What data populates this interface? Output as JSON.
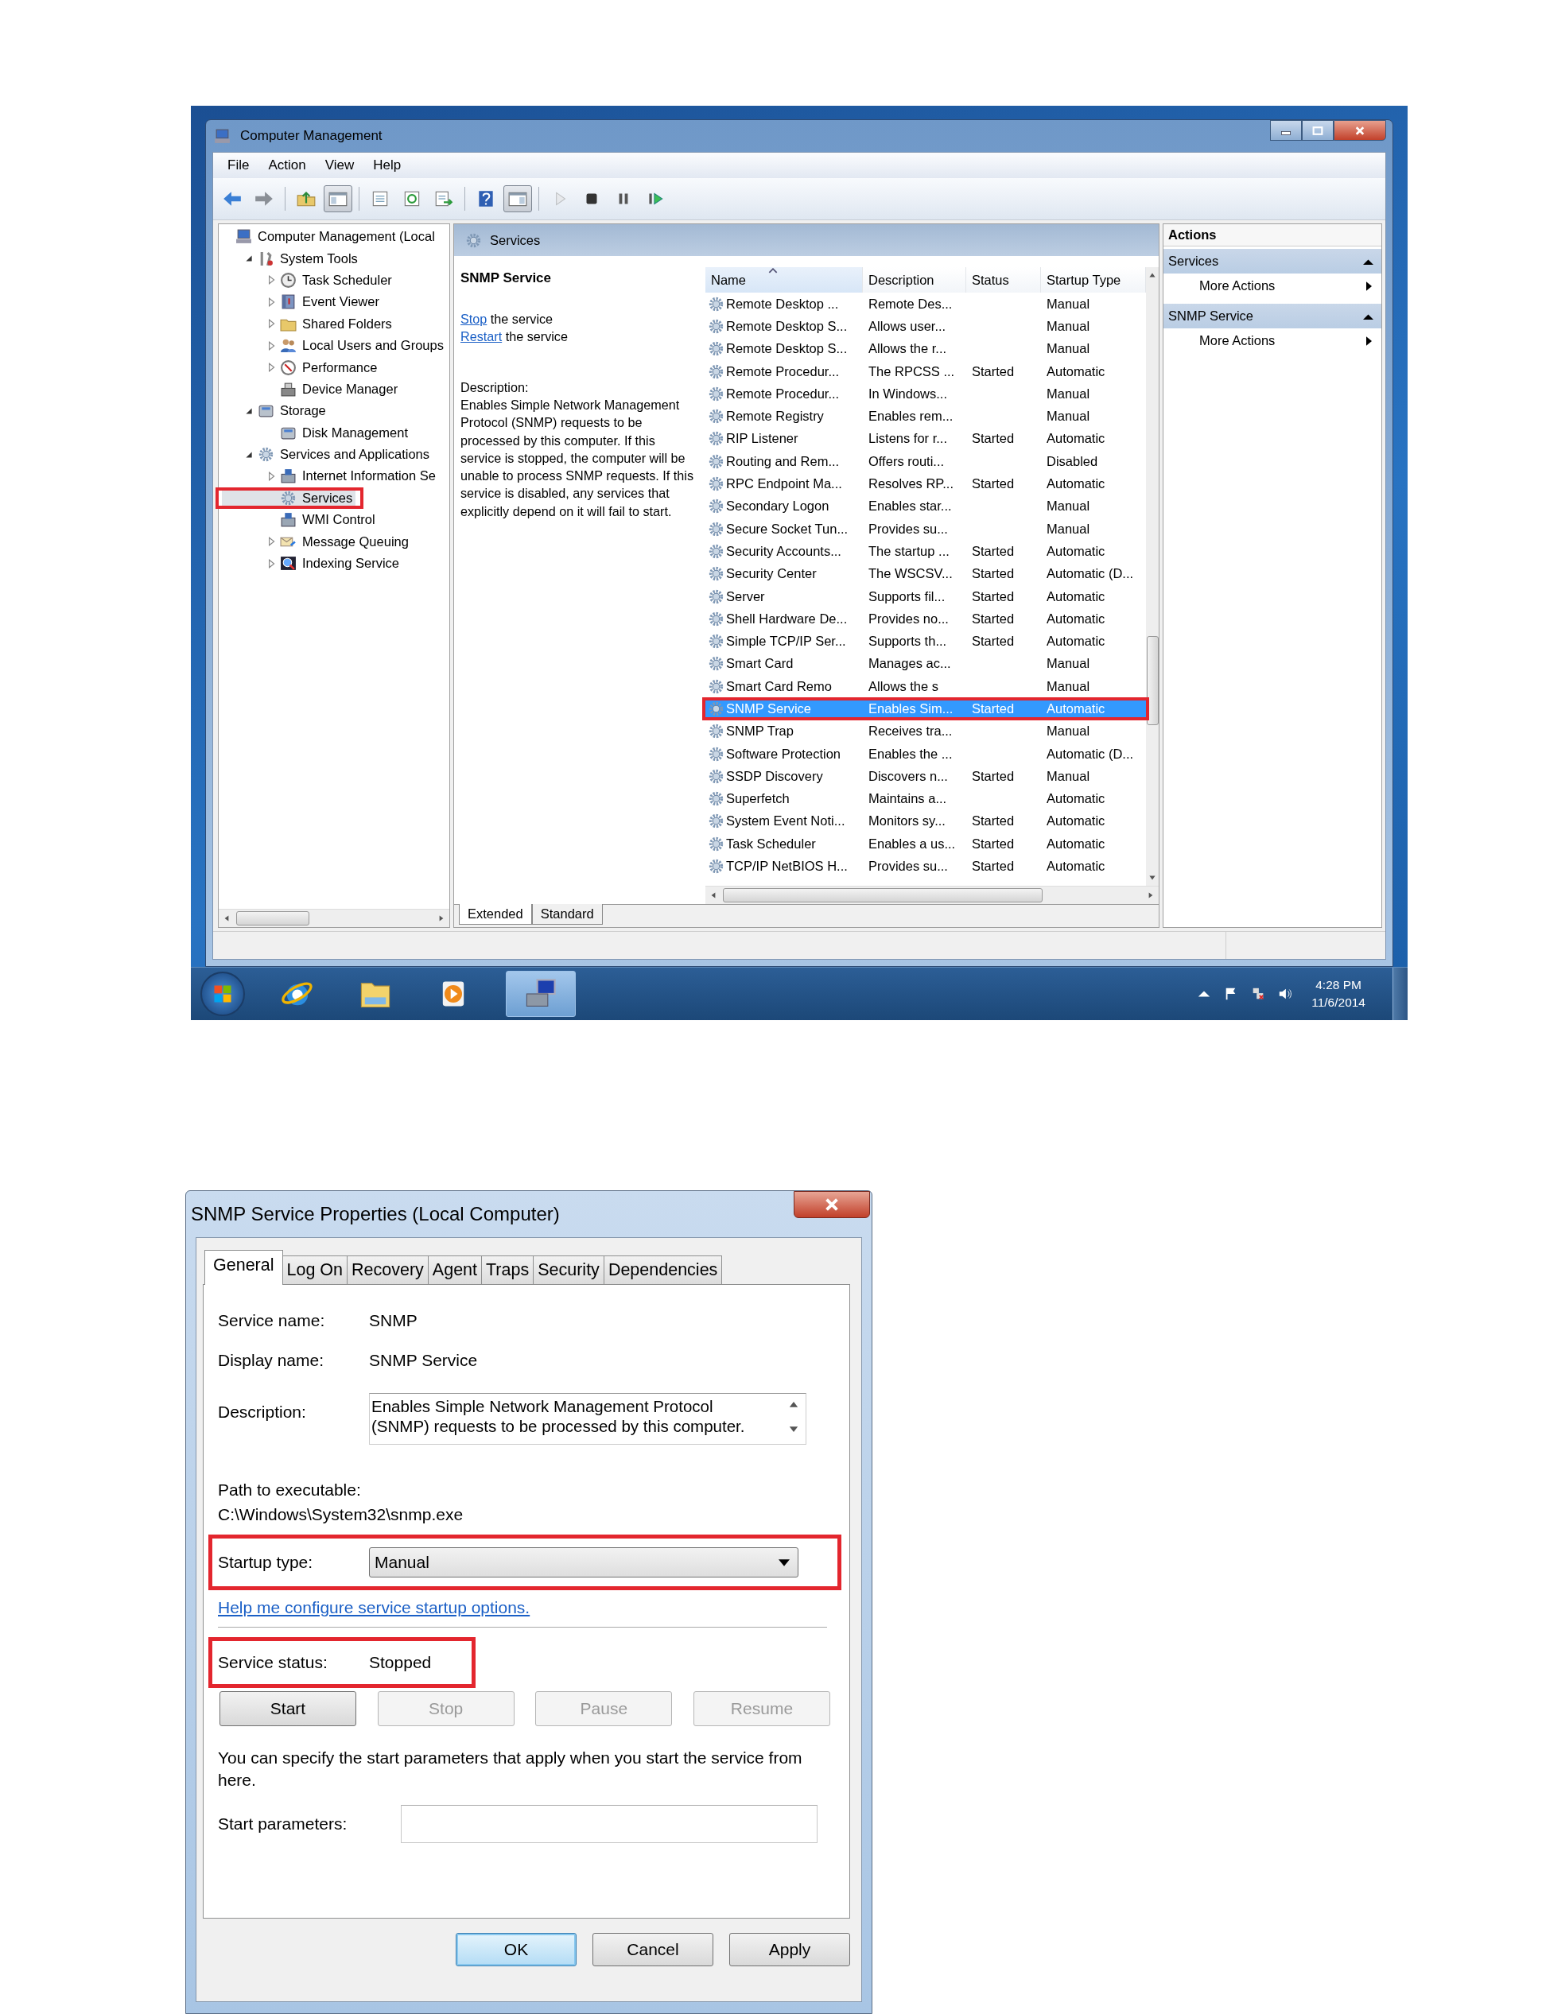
{
  "main_window": {
    "title": "Computer Management",
    "menu": [
      "File",
      "Action",
      "View",
      "Help"
    ],
    "toolbar": [
      {
        "kind": "back",
        "pressed": false,
        "disabled": false
      },
      {
        "kind": "forward",
        "pressed": false,
        "disabled": false
      },
      {
        "kind": "separator"
      },
      {
        "kind": "up",
        "pressed": false,
        "disabled": false
      },
      {
        "kind": "tree_toggle",
        "pressed": true,
        "disabled": false
      },
      {
        "kind": "separator"
      },
      {
        "kind": "properties",
        "pressed": false,
        "disabled": false
      },
      {
        "kind": "refresh",
        "pressed": false,
        "disabled": false
      },
      {
        "kind": "export",
        "pressed": false,
        "disabled": false
      },
      {
        "kind": "separator"
      },
      {
        "kind": "help",
        "pressed": false,
        "disabled": false
      },
      {
        "kind": "actions_toggle",
        "pressed": true,
        "disabled": false
      },
      {
        "kind": "separator"
      },
      {
        "kind": "play",
        "pressed": false,
        "disabled": true
      },
      {
        "kind": "stop",
        "pressed": false,
        "disabled": false
      },
      {
        "kind": "pause",
        "pressed": false,
        "disabled": false
      },
      {
        "kind": "resume",
        "pressed": false,
        "disabled": false
      }
    ],
    "tree": [
      {
        "label": "Computer Management (Local",
        "kind": "computer",
        "expandable": false,
        "selected": false,
        "highlighted": false,
        "children": [
          {
            "label": "System Tools",
            "kind": "tools",
            "expandable": true,
            "expanded": true,
            "selected": false,
            "highlighted": false,
            "children": [
              {
                "label": "Task Scheduler",
                "kind": "clock",
                "expandable": true,
                "expanded": false,
                "selected": false,
                "highlighted": false
              },
              {
                "label": "Event Viewer",
                "kind": "book",
                "expandable": true,
                "expanded": false,
                "selected": false,
                "highlighted": false
              },
              {
                "label": "Shared Folders",
                "kind": "folder",
                "expandable": true,
                "expanded": false,
                "selected": false,
                "highlighted": false
              },
              {
                "label": "Local Users and Groups",
                "kind": "people",
                "expandable": true,
                "expanded": false,
                "selected": false,
                "highlighted": false
              },
              {
                "label": "Performance",
                "kind": "gauge",
                "expandable": true,
                "expanded": false,
                "selected": false,
                "highlighted": false
              },
              {
                "label": "Device Manager",
                "kind": "device",
                "expandable": false,
                "selected": false,
                "highlighted": false
              }
            ]
          },
          {
            "label": "Storage",
            "kind": "drive",
            "expandable": true,
            "expanded": true,
            "selected": false,
            "highlighted": false,
            "children": [
              {
                "label": "Disk Management",
                "kind": "drive",
                "expandable": false,
                "selected": false,
                "highlighted": false
              }
            ]
          },
          {
            "label": "Services and Applications",
            "kind": "gear",
            "expandable": true,
            "expanded": true,
            "selected": false,
            "highlighted": false,
            "children": [
              {
                "label": "Internet Information Se",
                "kind": "server",
                "expandable": true,
                "expanded": false,
                "selected": false,
                "highlighted": false
              },
              {
                "label": "Services",
                "kind": "gear",
                "expandable": false,
                "selected": true,
                "highlighted": true
              },
              {
                "label": "WMI Control",
                "kind": "server",
                "expandable": false,
                "selected": false,
                "highlighted": false
              },
              {
                "label": "Message Queuing",
                "kind": "envelope",
                "expandable": true,
                "expanded": false,
                "selected": false,
                "highlighted": false
              },
              {
                "label": "Indexing Service",
                "kind": "index",
                "expandable": true,
                "expanded": false,
                "selected": false,
                "highlighted": false
              }
            ]
          }
        ]
      }
    ],
    "center": {
      "header": "Services",
      "detail": {
        "title": "SNMP Service",
        "actions": [
          {
            "link": "Stop",
            "text": "the service"
          },
          {
            "link": "Restart",
            "text": "the service"
          }
        ],
        "description_label": "Description:",
        "description": "Enables Simple Network Management Protocol (SNMP) requests to be processed by this computer. If this service is stopped, the computer will be unable to process SNMP requests. If this service is disabled, any services that explicitly depend on it will fail to start."
      },
      "columns": [
        {
          "label": "Name",
          "sorted": true
        },
        {
          "label": "Description",
          "sorted": false
        },
        {
          "label": "Status",
          "sorted": false
        },
        {
          "label": "Startup Type",
          "sorted": false
        }
      ],
      "rows": [
        {
          "name": "Remote Desktop ...",
          "description": "Remote Des...",
          "startup": "Manual",
          "selected": false,
          "highlighted": false
        },
        {
          "name": "Remote Desktop S...",
          "description": "Allows user...",
          "startup": "Manual",
          "selected": false,
          "highlighted": false
        },
        {
          "name": "Remote Desktop S...",
          "description": "Allows the r...",
          "startup": "Manual",
          "selected": false,
          "highlighted": false
        },
        {
          "name": "Remote Procedur...",
          "description": "The RPCSS ...",
          "status": "Started",
          "startup": "Automatic",
          "selected": false,
          "highlighted": false
        },
        {
          "name": "Remote Procedur...",
          "description": "In Windows...",
          "startup": "Manual",
          "selected": false,
          "highlighted": false
        },
        {
          "name": "Remote Registry",
          "description": "Enables rem...",
          "startup": "Manual",
          "selected": false,
          "highlighted": false
        },
        {
          "name": "RIP Listener",
          "description": "Listens for r...",
          "status": "Started",
          "startup": "Automatic",
          "selected": false,
          "highlighted": false
        },
        {
          "name": "Routing and Rem...",
          "description": "Offers routi...",
          "startup": "Disabled",
          "selected": false,
          "highlighted": false
        },
        {
          "name": "RPC Endpoint Ma...",
          "description": "Resolves RP...",
          "status": "Started",
          "startup": "Automatic",
          "selected": false,
          "highlighted": false
        },
        {
          "name": "Secondary Logon",
          "description": "Enables star...",
          "startup": "Manual",
          "selected": false,
          "highlighted": false
        },
        {
          "name": "Secure Socket Tun...",
          "description": "Provides su...",
          "startup": "Manual",
          "selected": false,
          "highlighted": false
        },
        {
          "name": "Security Accounts...",
          "description": "The startup ...",
          "status": "Started",
          "startup": "Automatic",
          "selected": false,
          "highlighted": false
        },
        {
          "name": "Security Center",
          "description": "The WSCSV...",
          "status": "Started",
          "startup": "Automatic (D...",
          "selected": false,
          "highlighted": false
        },
        {
          "name": "Server",
          "description": "Supports fil...",
          "status": "Started",
          "startup": "Automatic",
          "selected": false,
          "highlighted": false
        },
        {
          "name": "Shell Hardware De...",
          "description": "Provides no...",
          "status": "Started",
          "startup": "Automatic",
          "selected": false,
          "highlighted": false
        },
        {
          "name": "Simple TCP/IP Ser...",
          "description": "Supports th...",
          "status": "Started",
          "startup": "Automatic",
          "selected": false,
          "highlighted": false
        },
        {
          "name": "Smart Card",
          "description": "Manages ac...",
          "startup": "Manual",
          "selected": false,
          "highlighted": false
        },
        {
          "name": "Smart Card Remo",
          "description": "Allows the s",
          "startup": "Manual",
          "selected": false,
          "highlighted": false
        },
        {
          "name": "SNMP Service",
          "description": "Enables Sim...",
          "status": "Started",
          "startup": "Automatic",
          "selected": true,
          "highlighted": true
        },
        {
          "name": "SNMP Trap",
          "description": "Receives tra...",
          "startup": "Manual",
          "selected": false,
          "highlighted": false
        },
        {
          "name": "Software Protection",
          "description": "Enables the ...",
          "startup": "Automatic (D...",
          "selected": false,
          "highlighted": false
        },
        {
          "name": "SSDP Discovery",
          "description": "Discovers n...",
          "status": "Started",
          "startup": "Manual",
          "selected": false,
          "highlighted": false
        },
        {
          "name": "Superfetch",
          "description": "Maintains a...",
          "startup": "Automatic",
          "selected": false,
          "highlighted": false
        },
        {
          "name": "System Event Noti...",
          "description": "Monitors sy...",
          "status": "Started",
          "startup": "Automatic",
          "selected": false,
          "highlighted": false
        },
        {
          "name": "Task Scheduler",
          "description": "Enables a us...",
          "status": "Started",
          "startup": "Automatic",
          "selected": false,
          "highlighted": false
        },
        {
          "name": "TCP/IP NetBIOS H...",
          "description": "Provides su...",
          "status": "Started",
          "startup": "Automatic",
          "selected": false,
          "highlighted": false
        }
      ],
      "view_tabs": [
        {
          "label": "Extended",
          "selected": true
        },
        {
          "label": "Standard",
          "selected": false
        }
      ]
    },
    "actions": {
      "title": "Actions",
      "groups": [
        {
          "title": "Services",
          "items": [
            "More Actions"
          ]
        },
        {
          "title": "SNMP Service",
          "items": [
            "More Actions"
          ]
        }
      ]
    }
  },
  "taskbar": {
    "buttons": [
      {
        "kind": "browser",
        "active": false
      },
      {
        "kind": "explorer",
        "active": false
      },
      {
        "kind": "media",
        "active": false
      },
      {
        "kind": "management",
        "active": true
      }
    ],
    "time": "4:28 PM",
    "date": "11/6/2014"
  },
  "dialog": {
    "title": "SNMP Service Properties (Local Computer)",
    "tabs": [
      {
        "label": "General",
        "selected": true
      },
      {
        "label": "Log On",
        "selected": false
      },
      {
        "label": "Recovery",
        "selected": false
      },
      {
        "label": "Agent",
        "selected": false
      },
      {
        "label": "Traps",
        "selected": false
      },
      {
        "label": "Security",
        "selected": false
      },
      {
        "label": "Dependencies",
        "selected": false
      }
    ],
    "service_name_label": "Service name:",
    "service_name": "SNMP",
    "display_name_label": "Display name:",
    "display_name": "SNMP Service",
    "description_label": "Description:",
    "description": "Enables Simple Network Management Protocol (SNMP) requests to be processed by this computer.",
    "path_label": "Path to executable:",
    "path": "C:\\Windows\\System32\\snmp.exe",
    "startup_label": "Startup type:",
    "startup_value": "Manual",
    "startup_highlighted": true,
    "help_link": "Help me configure service startup options.",
    "status_label": "Service status:",
    "status_value": "Stopped",
    "status_highlighted": true,
    "service_buttons": [
      {
        "label": "Start",
        "disabled": false
      },
      {
        "label": "Stop",
        "disabled": true
      },
      {
        "label": "Pause",
        "disabled": true
      },
      {
        "label": "Resume",
        "disabled": true
      }
    ],
    "params_note": "You can specify the start parameters that apply when you start the service from here.",
    "params_label": "Start parameters:",
    "buttons": [
      {
        "label": "OK",
        "default": true
      },
      {
        "label": "Cancel",
        "default": false
      },
      {
        "label": "Apply",
        "default": false
      }
    ]
  }
}
